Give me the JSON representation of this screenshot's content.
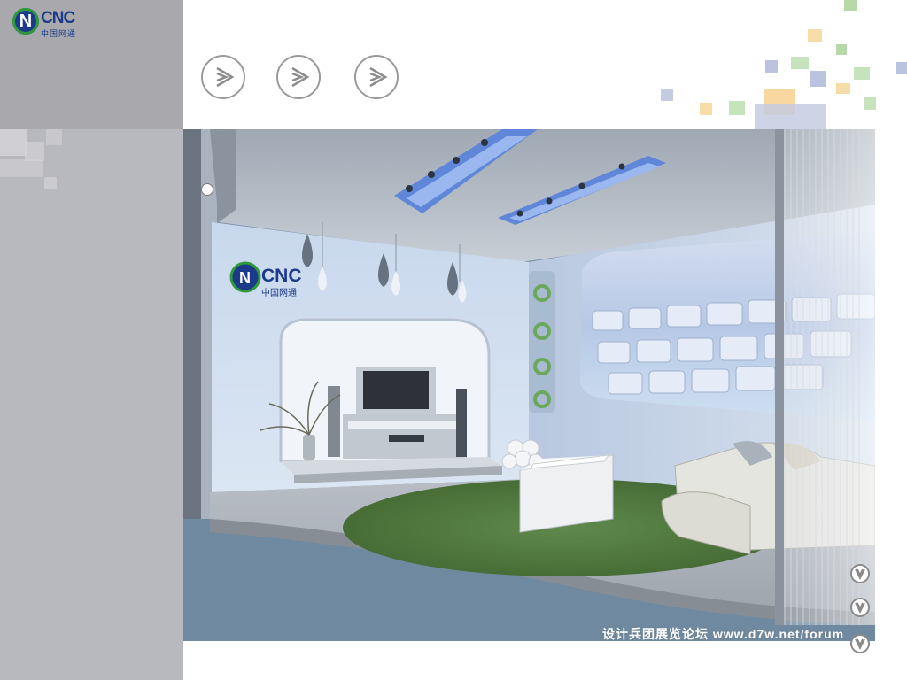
{
  "brand": {
    "logo_letter": "N",
    "logo_text": "CNC",
    "logo_subtitle": "中国网通",
    "primary_color": "#1c3a8a",
    "accent_color": "#2f9a3c"
  },
  "nav": {
    "buttons": [
      {
        "icon": "chevron-right-icon"
      },
      {
        "icon": "chevron-right-icon"
      },
      {
        "icon": "chevron-right-icon"
      }
    ]
  },
  "scene": {
    "wall_logo_letter": "N",
    "wall_logo_text": "CNC",
    "wall_logo_subtitle": "中国网通"
  },
  "watermark": "设计兵团展览论坛 www.d7w.net/forum",
  "side_controls": {
    "down_buttons": [
      {
        "icon": "chevron-down-icon"
      },
      {
        "icon": "chevron-down-icon"
      },
      {
        "icon": "chevron-down-icon"
      }
    ]
  }
}
